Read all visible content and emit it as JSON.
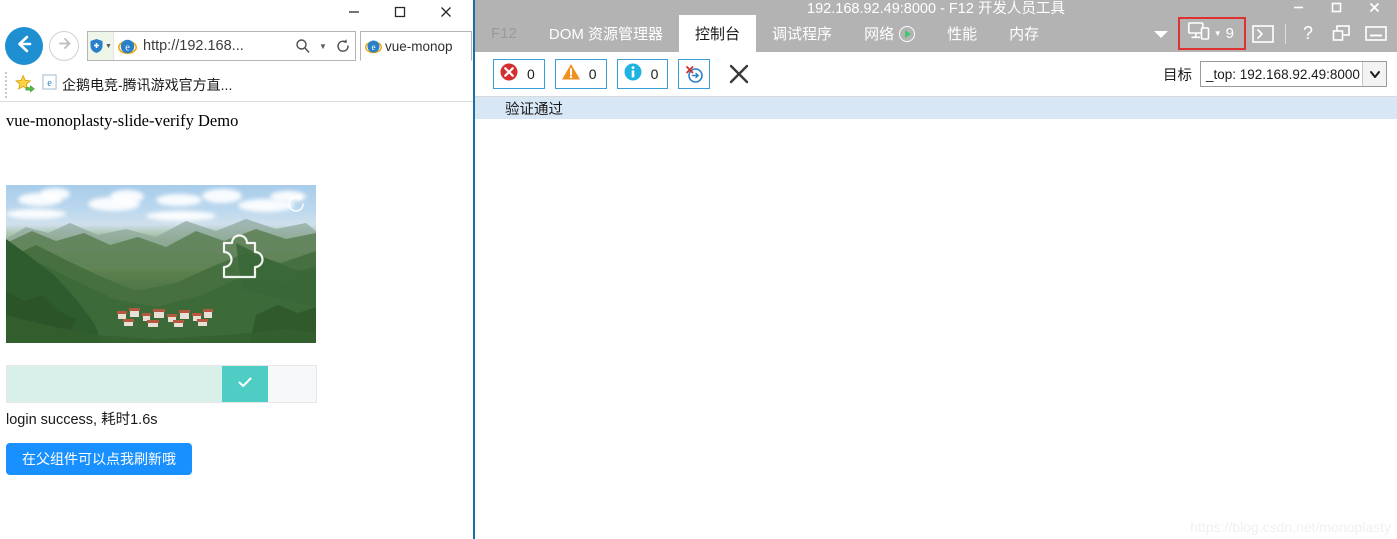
{
  "browser": {
    "window_controls": [
      "minimize",
      "maximize",
      "close"
    ],
    "nav": {
      "back_icon": "back-arrow-icon",
      "forward_icon": "forward-arrow-icon",
      "shield_icon": "tracking-protection-icon",
      "favicon": "ie-logo-icon",
      "url": "http://192.168...",
      "search_icon": "search-icon",
      "refresh_icon": "refresh-icon"
    },
    "tab": {
      "favicon": "ie-logo-icon",
      "title": "vue-monop"
    },
    "favorites": {
      "star_icon": "favorites-star-icon",
      "item_icon": "ie-page-icon",
      "item_label": "企鹅电竞-腾讯游戏官方直..."
    }
  },
  "page": {
    "title": "vue-monoplasty-slide-verify Demo",
    "captcha": {
      "refresh_icon": "captcha-refresh-icon",
      "puzzle_icon": "puzzle-piece-hole-icon",
      "image_alt": "mountain-valley-landscape"
    },
    "slider": {
      "handle_icon": "check-icon",
      "state": "success",
      "fill_color": "#d8f0e9",
      "handle_color": "#4ecdc4"
    },
    "status_text": "login success, 耗时1.6s",
    "refresh_button_label": "在父组件可以点我刷新哦",
    "accent_color": "#1890ff"
  },
  "devtools": {
    "title": "192.168.92.49:8000 - F12 开发人员工具",
    "window_controls": [
      "minimize",
      "maximize",
      "close"
    ],
    "tabs": [
      {
        "label": "F12",
        "state": "disabled"
      },
      {
        "label": "DOM 资源管理器",
        "state": "normal"
      },
      {
        "label": "控制台",
        "state": "active"
      },
      {
        "label": "调试程序",
        "state": "normal"
      },
      {
        "label": "网络",
        "state": "normal",
        "icon": "play-icon"
      },
      {
        "label": "性能",
        "state": "normal"
      },
      {
        "label": "内存",
        "state": "normal"
      }
    ],
    "toolbar_icons": [
      {
        "name": "overflow-chevron-icon"
      },
      {
        "name": "console-prompt-icon"
      },
      {
        "name": "help-icon",
        "label": "?"
      },
      {
        "name": "dock-windows-icon"
      },
      {
        "name": "minimize-pane-icon"
      }
    ],
    "device_emulation": {
      "icon": "device-emulation-icon",
      "caret": "chevron-down-icon",
      "value": "9",
      "highlight_color": "#e03131"
    },
    "console": {
      "errors": {
        "icon": "error-icon",
        "count": "0"
      },
      "warnings": {
        "icon": "warning-icon",
        "count": "0"
      },
      "infos": {
        "icon": "info-icon",
        "count": "0"
      },
      "clear_on_navigate_icon": "clear-on-navigate-icon",
      "clear_icon": "clear-console-icon",
      "target_label": "目标",
      "target_value": "_top: 192.168.92.49:8000",
      "target_caret": "chevron-down-icon",
      "messages": [
        {
          "text": "验证通过",
          "selected": true
        }
      ]
    }
  },
  "watermark": "https://blog.csdn.net/monoplasty"
}
